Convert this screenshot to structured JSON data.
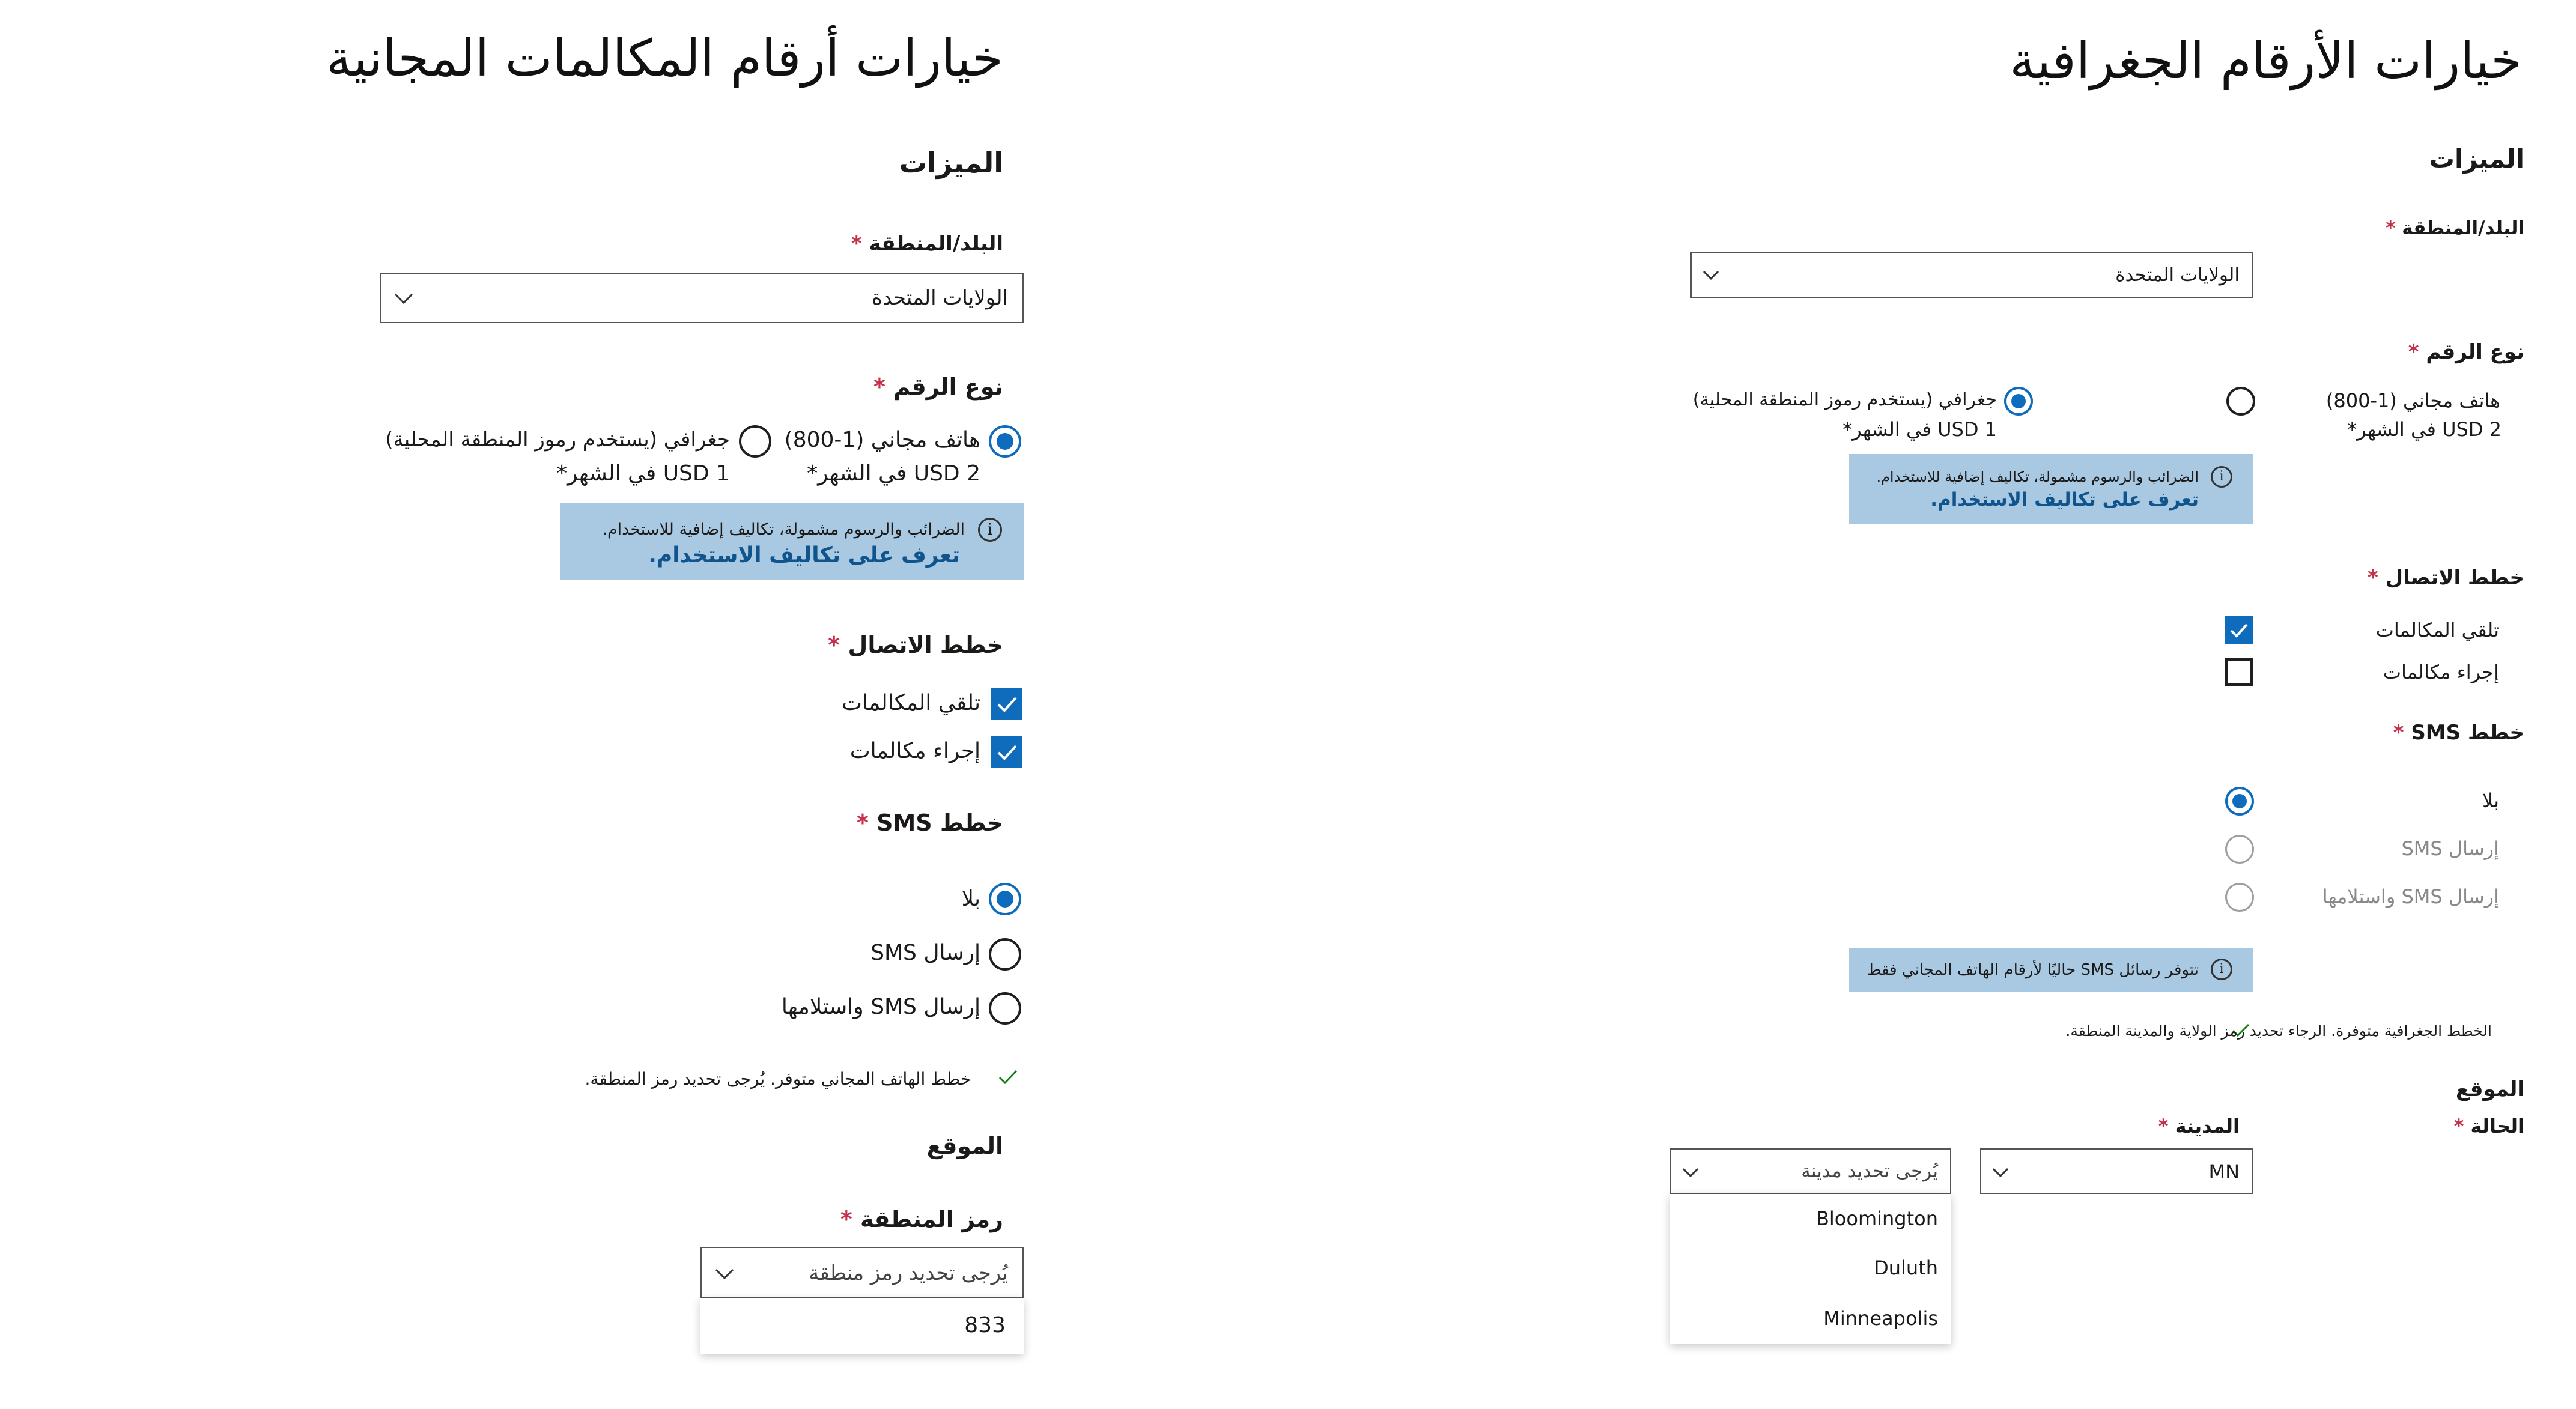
{
  "toll_free": {
    "title": "خيارات أرقام المكالمات المجانية",
    "features": "الميزات",
    "country_label": "البلد/المنطقة",
    "required_mark": "*",
    "country_value": "الولايات المتحدة",
    "number_type_label": "نوع الرقم",
    "option_toll_free": "هاتف مجاني (1-800)",
    "option_toll_free_price": "2 USD في الشهر*",
    "option_geographic": "جغرافي (يستخدم رموز المنطقة المحلية)",
    "option_geographic_price": "1 USD في الشهر*",
    "info_text": "الضرائب والرسوم مشمولة، تكاليف إضافية للاستخدام.",
    "info_link": "تعرف على تكاليف الاستخدام.",
    "calling_plans_label": "خطط الاتصال",
    "plan_receive": "تلقي المكالمات",
    "plan_make": "إجراء مكالمات",
    "sms_plans_label": "خطط SMS",
    "sms_none": "بلا",
    "sms_send": "إرسال SMS",
    "sms_send_receive": "إرسال SMS واستلامها",
    "availability_note": "خطط الهاتف المجاني متوفر. يُرجى تحديد رمز المنطقة.",
    "location_label": "الموقع",
    "area_code_label": "رمز المنطقة",
    "area_code_placeholder": "يُرجى تحديد رمز منطقة",
    "area_code_options": [
      "833"
    ]
  },
  "geographic": {
    "title": "خيارات الأرقام الجغرافية",
    "features": "الميزات",
    "country_label": "البلد/المنطقة",
    "required_mark": "*",
    "country_value": "الولايات المتحدة",
    "number_type_label": "نوع الرقم",
    "option_toll_free": "هاتف مجاني (1-800)",
    "option_toll_free_price": "2 USD في الشهر*",
    "option_geographic": "جغرافي (يستخدم رموز المنطقة المحلية)",
    "option_geographic_price": "1 USD في الشهر*",
    "info_text": "الضرائب والرسوم مشمولة، تكاليف إضافية للاستخدام.",
    "info_link": "تعرف على تكاليف الاستخدام.",
    "calling_plans_label": "خطط الاتصال",
    "plan_receive": "تلقي المكالمات",
    "plan_make": "إجراء مكالمات",
    "sms_plans_label": "خطط SMS",
    "sms_none": "بلا",
    "sms_send": "إرسال SMS",
    "sms_send_receive": "إرسال SMS واستلامها",
    "sms_info": "تتوفر رسائل SMS حاليًا لأرقام الهاتف المجاني فقط",
    "availability_note": "الخطط الجغرافية متوفرة. الرجاء تحديد رمز الولاية والمدينة المنطقة.",
    "location_label": "الموقع",
    "state_label": "الحالة",
    "state_value": "MN",
    "city_label": "المدينة",
    "city_placeholder": "يُرجى تحديد مدينة",
    "city_options": [
      "Bloomington",
      "Duluth",
      "Minneapolis"
    ]
  },
  "colors": {
    "accent": "#0f6cbd",
    "info_bg": "#a9c9e3",
    "required": "#c4314b",
    "success": "#107c10"
  }
}
